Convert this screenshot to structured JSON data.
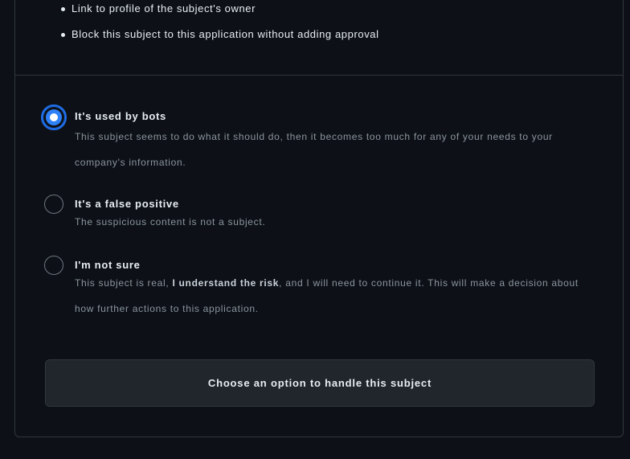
{
  "top_list": {
    "items": [
      "Link to profile of the subject's owner",
      "Block this subject to this application without adding approval"
    ]
  },
  "options": [
    {
      "title": "It's used by bots",
      "selected": true,
      "description_before": "This subject seems to do what it should do, then it becomes too much for any of your needs to your company's information.",
      "description_bold": "",
      "description_after": ""
    },
    {
      "title": "It's a false positive",
      "selected": false,
      "description_before": "The suspicious content is not a subject.",
      "description_bold": "",
      "description_after": ""
    },
    {
      "title": "I'm not sure",
      "selected": false,
      "description_before": "This subject is real, ",
      "description_bold": "I understand the risk",
      "description_after": ", and I will need to continue it. This will make a decision about how further actions to this application."
    }
  ],
  "submit": {
    "label": "Choose an option to handle this subject"
  }
}
